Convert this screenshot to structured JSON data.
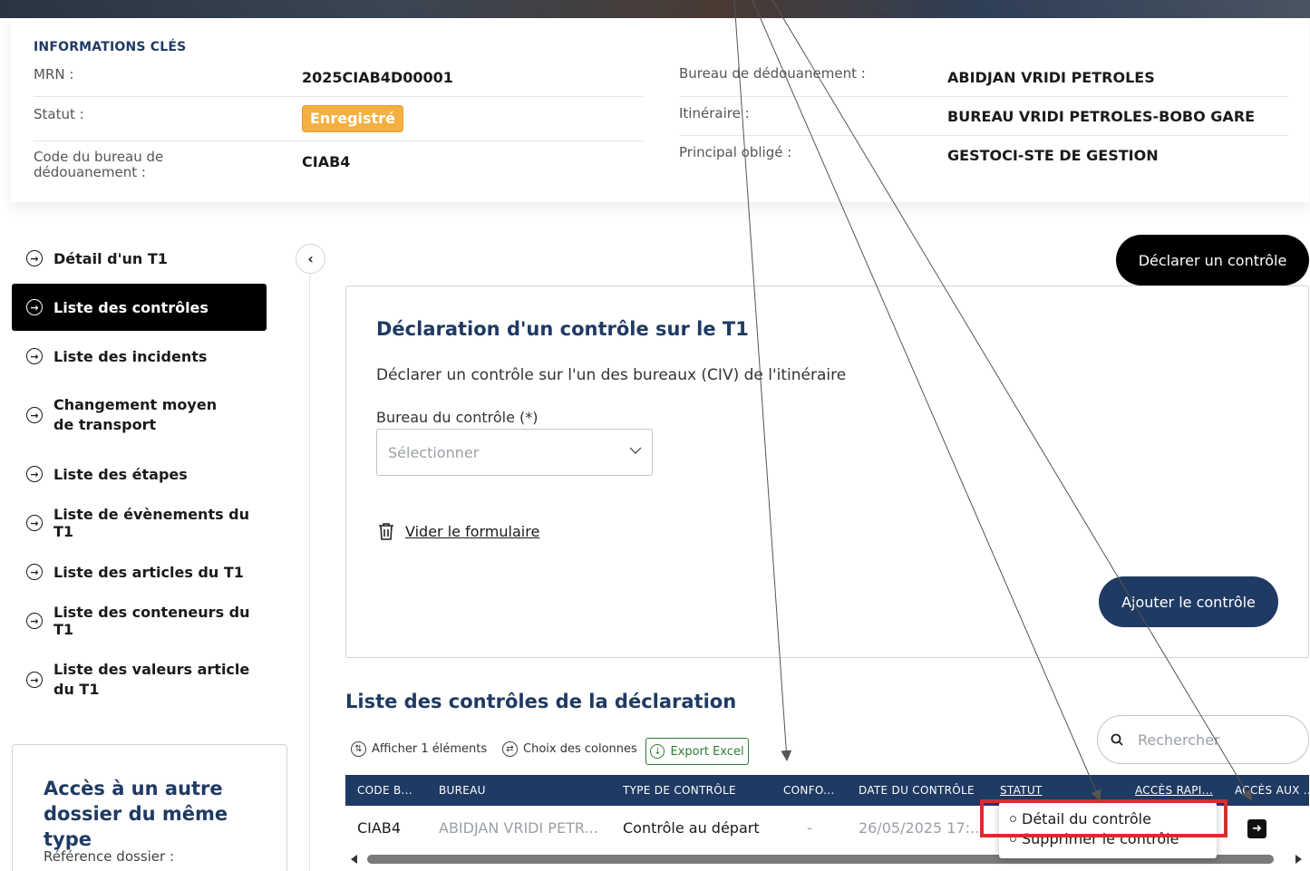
{
  "info": {
    "title": "INFORMATIONS CLÉS",
    "mrn_label": "MRN :",
    "mrn_value": "2025CIAB4D00001",
    "statut_label": "Statut :",
    "statut_value": "Enregistré",
    "code_label": "Code du bureau de dédouanement :",
    "code_value": "CIAB4",
    "bureau_label": "Bureau de dédouanement :",
    "bureau_value": "ABIDJAN VRIDI PETROLES",
    "itineraire_label": "Itinéraire :",
    "itineraire_value": "BUREAU VRIDI PETROLES-BOBO GARE",
    "principal_label": "Principal obligé :",
    "principal_value": "GESTOCI-STE DE GESTION",
    "badge_color": "#f5b042"
  },
  "sidebar": {
    "items": [
      {
        "label": "Détail d'un T1"
      },
      {
        "label": "Liste des contrôles"
      },
      {
        "label": "Liste des incidents"
      },
      {
        "label": "Changement moyen de transport"
      },
      {
        "label": "Liste des étapes"
      },
      {
        "label": "Liste de évènements du T1"
      },
      {
        "label": "Liste des articles du T1"
      },
      {
        "label": "Liste des conteneurs du T1"
      },
      {
        "label": "Liste des valeurs article du T1"
      }
    ],
    "active_index": 1,
    "other_title": "Accès à un autre dossier du même type",
    "other_label": "Référence dossier :"
  },
  "actions": {
    "declare_label": "Déclarer un contrôle"
  },
  "form": {
    "title": "Déclaration d'un contrôle sur le T1",
    "description": "Déclarer un contrôle sur l'un des bureaux (CIV) de l'itinéraire",
    "bureau_label": "Bureau du contrôle (*)",
    "bureau_placeholder": "Sélectionner",
    "clear_label": "Vider le formulaire",
    "submit_label": "Ajouter le contrôle"
  },
  "list": {
    "title": "Liste des contrôles de la déclaration",
    "show_label": "Afficher 1 éléments",
    "columns_label": "Choix des colonnes",
    "export_label": "Export Excel",
    "search_placeholder": "Rechercher",
    "headers": [
      "CODE B...",
      "BUREAU",
      "TYPE DE CONTRÔLE",
      "CONFO...",
      "DATE DU CONTRÔLE",
      "STATUT",
      "ACCÈS RAPI...",
      "ACCÈS AUX ..."
    ],
    "rows": [
      {
        "code": "CIAB4",
        "bureau": "ABIDJAN VRIDI PETR...",
        "type": "Contrôle au départ",
        "conformite": "-",
        "date": "26/05/2025 17:..."
      }
    ],
    "header_color": "#1f3a63"
  },
  "menu": {
    "items": [
      "Détail du contrôle",
      "Supprimer le contrôle"
    ],
    "highlight_color": "#d32f2f"
  }
}
